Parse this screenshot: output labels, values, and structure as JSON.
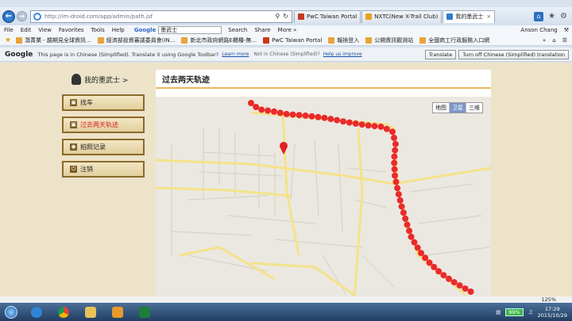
{
  "browser": {
    "url": "http://im-droid.com/app/admin/path.jsf",
    "tabs": [
      {
        "label": "PwC Taiwan Portal",
        "color": "#c7381f",
        "active": false
      },
      {
        "label": "NXTC(New X-Trail Club)",
        "color": "#e8a21f",
        "active": false
      },
      {
        "label": "我的墨武士",
        "color": "#2d7dd2",
        "active": true
      }
    ],
    "menu": [
      "File",
      "Edit",
      "View",
      "Favorites",
      "Tools",
      "Help"
    ],
    "google_label": "Google",
    "google_query": "墨武士",
    "toolbar": {
      "search": "Search",
      "share": "Share",
      "more": "More »"
    },
    "account": {
      "user": "Anson Chang"
    },
    "favorites": [
      "潛菁業 - 趨期見全球資訊...",
      "經濟部投資審議委員會(IN...",
      "新北市政府網路E櫃檯-無...",
      "PwC Taiwan Portal",
      "報換登入",
      "公開資訊觀測站",
      "全國商工行政服務入口網"
    ]
  },
  "translate": {
    "brand": "Google",
    "message": "This page is in Chinese (Simplified).  Translate it using Google Toolbar?",
    "learn_more": "Learn more",
    "not_chinese": "Not in Chinese (Simplified)?",
    "help": "Help us improve",
    "translate_btn": "Translate",
    "off_btn": "Turn off Chinese (Simplified) translation"
  },
  "sidebar": {
    "user_label": "我的墨武士 >",
    "items": [
      {
        "label": "找车",
        "active": false
      },
      {
        "label": "过去两天轨迹",
        "active": true
      },
      {
        "label": "拍照记录",
        "active": false
      },
      {
        "label": "注销",
        "active": false
      }
    ]
  },
  "main": {
    "title": "过去两天轨迹",
    "map_types": [
      "地图",
      "卫星",
      "三维"
    ],
    "map_type_selected": "卫星"
  },
  "statusbar": {
    "zoom": "125%"
  },
  "taskbar": {
    "battery": "99%",
    "time": "17:29",
    "date": "2015/10/29"
  }
}
